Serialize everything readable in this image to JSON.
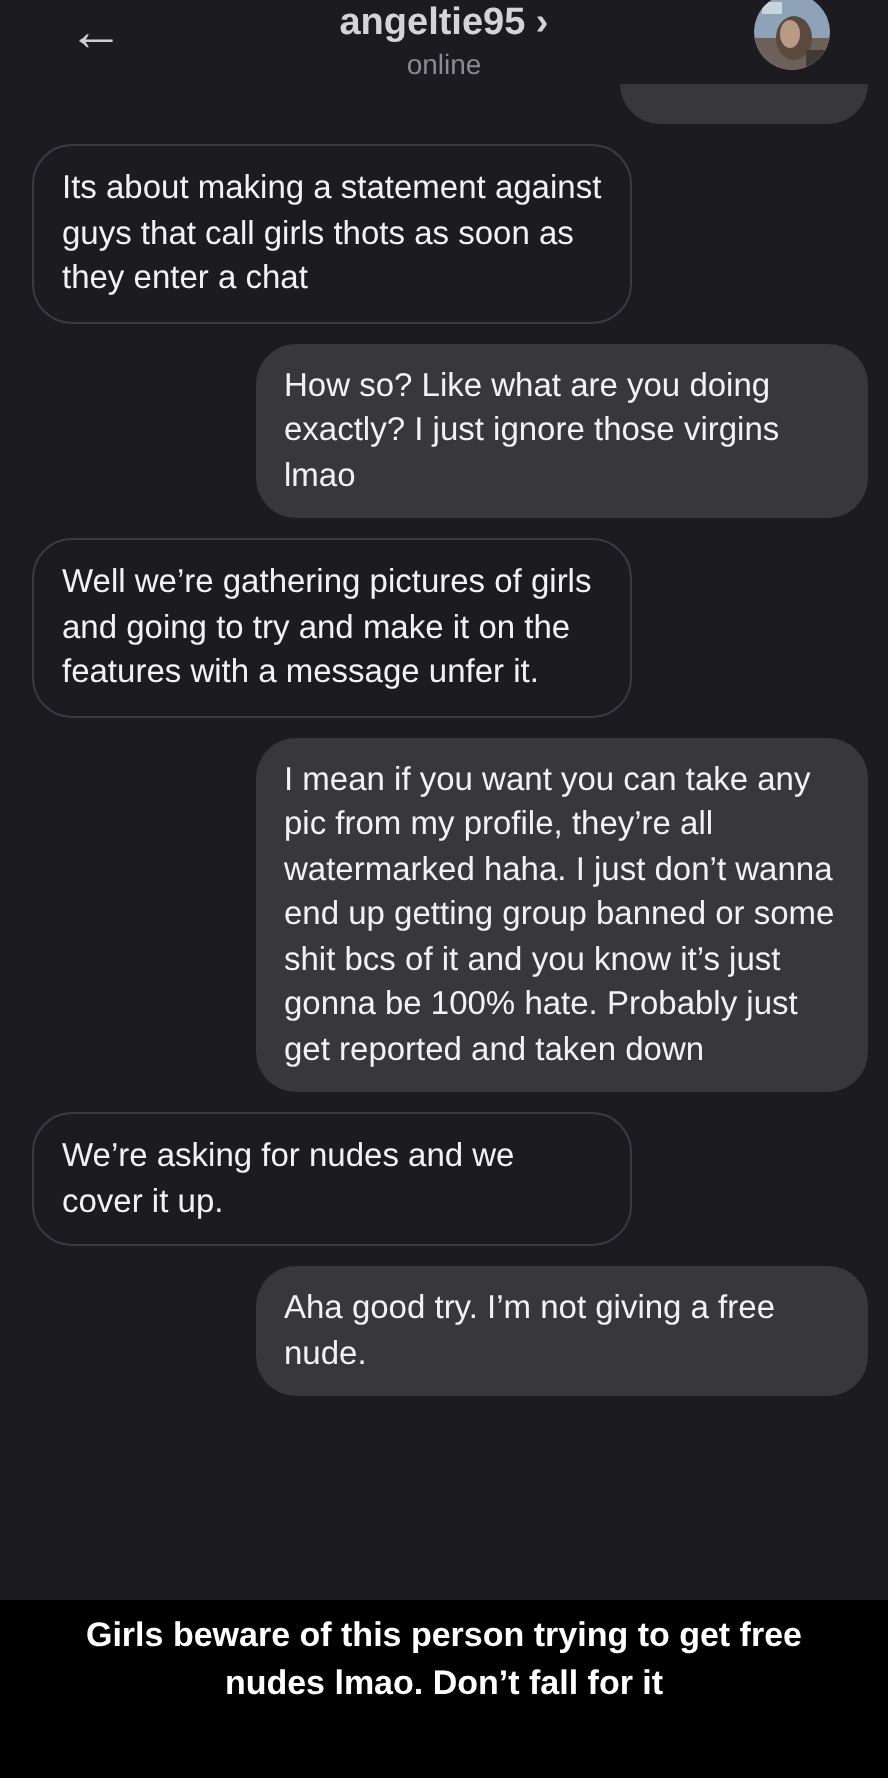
{
  "header": {
    "back_icon": "←",
    "username": "angeltie95 ›",
    "status": "online"
  },
  "messages": [
    {
      "kind": "received",
      "text": "Its about making a statement against guys that call girls thots as soon as they enter a chat"
    },
    {
      "kind": "sent",
      "text": "How so? Like what are you doing exactly? I just ignore those virgins lmao"
    },
    {
      "kind": "received",
      "text": "Well we’re gathering pictures of girls and going to try and make it on the features with a message unfer it."
    },
    {
      "kind": "sent",
      "text": "I mean if you want you can take any pic from my profile, they’re all watermarked haha. I just don’t wanna end up getting group banned or some shit bcs of it and you know it’s just gonna be 100% hate. Probably just get reported and taken down"
    },
    {
      "kind": "received",
      "text": "We’re asking for nudes and we cover it up."
    },
    {
      "kind": "sent",
      "text": "Aha good try. I’m not giving a free nude."
    }
  ],
  "caption": "Girls beware of this person trying to get free nudes lmao. Don’t fall for it"
}
